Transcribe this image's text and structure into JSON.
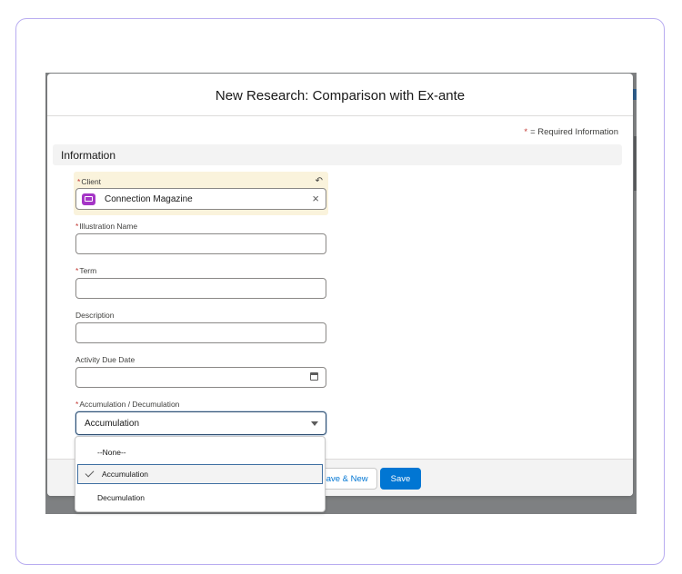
{
  "modal": {
    "title": "New Research: Comparison with Ex-ante",
    "required_note_star": "*",
    "required_note_text": "= Required Information"
  },
  "section": {
    "title": "Information"
  },
  "fields": {
    "client": {
      "required": "*",
      "label": "Client",
      "value": "Connection Magazine",
      "icon": "record-icon"
    },
    "illustration_name": {
      "required": "*",
      "label": "Illustration Name",
      "value": ""
    },
    "term": {
      "required": "*",
      "label": "Term",
      "value": ""
    },
    "description": {
      "label": "Description",
      "value": ""
    },
    "activity_due_date": {
      "label": "Activity Due Date",
      "value": "",
      "icon": "calendar-icon"
    },
    "accumulation": {
      "required": "*",
      "label": "Accumulation / Decumulation",
      "value": "Accumulation"
    }
  },
  "dropdown": {
    "options": [
      "--None--",
      "Accumulation",
      "Decumulation"
    ],
    "selected": "Accumulation"
  },
  "footer": {
    "save_new_label": "Save & New",
    "save_label": "Save"
  },
  "colors": {
    "brand": "#0176d3",
    "required": "#c23934",
    "frame": "#b8acf0",
    "record_icon": "#a535c6"
  }
}
